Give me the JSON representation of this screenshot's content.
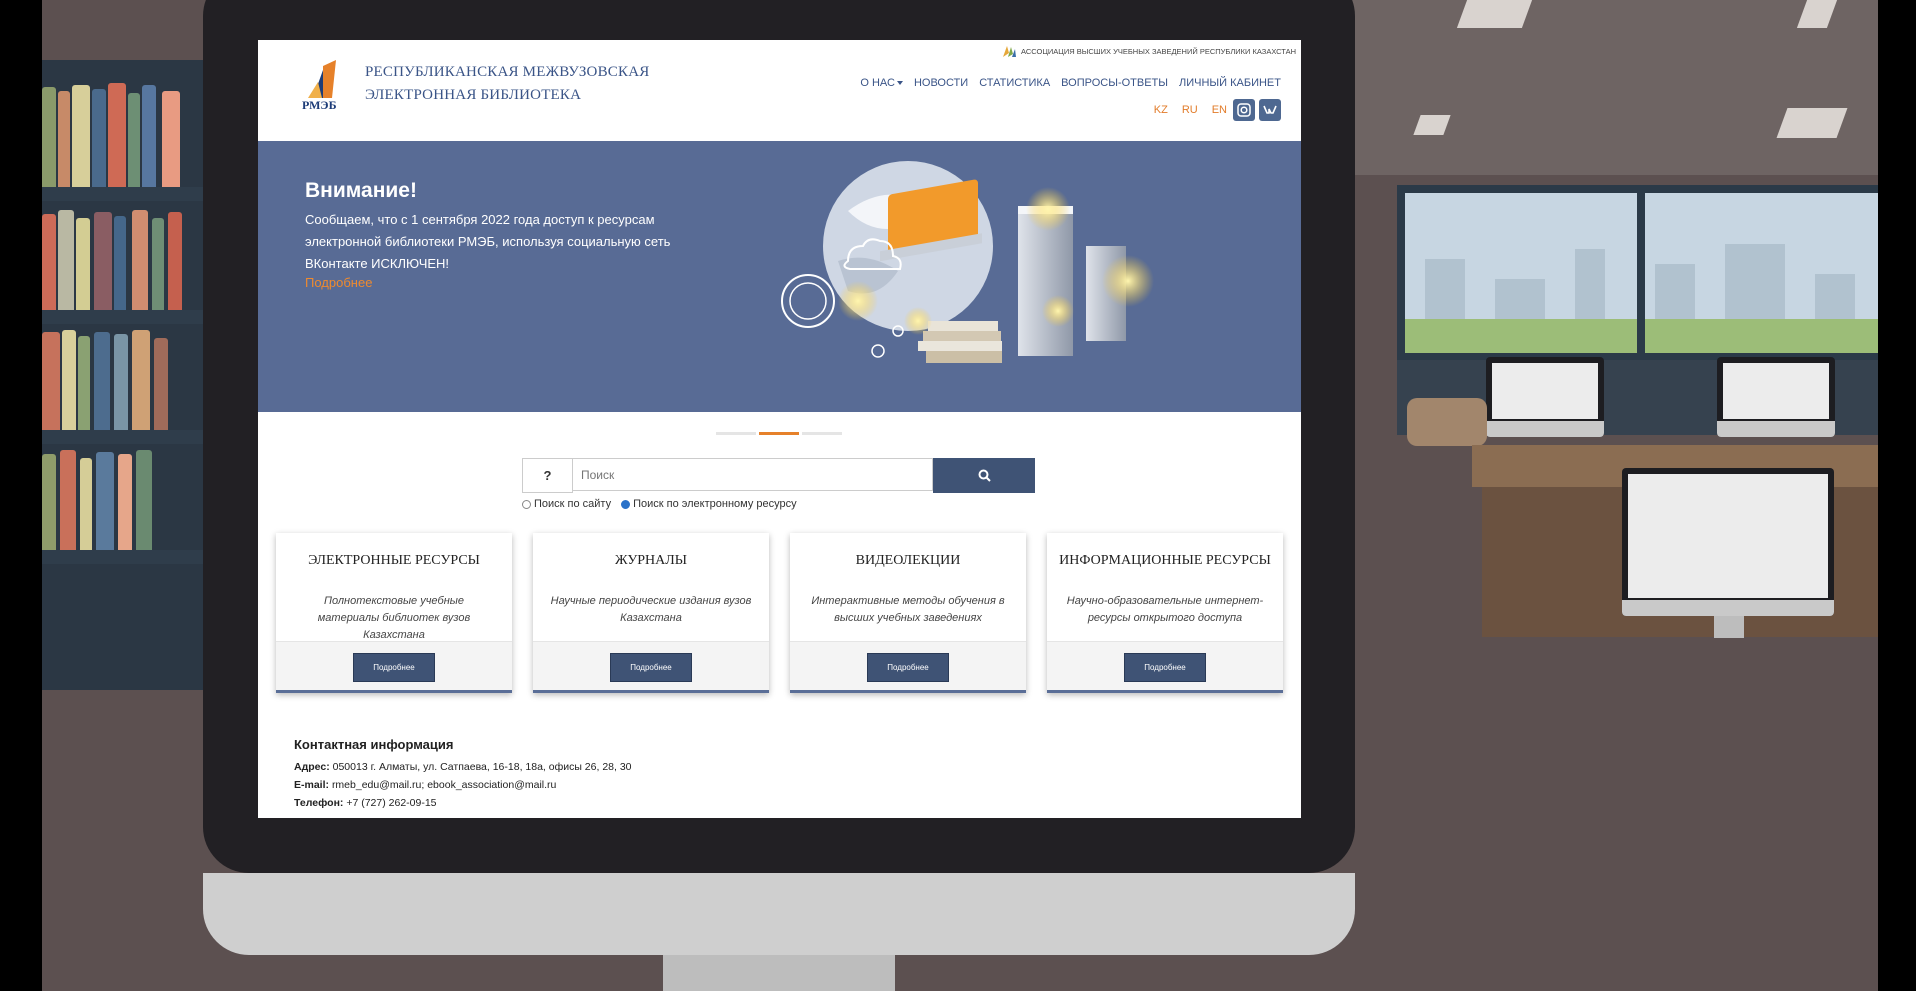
{
  "site": {
    "title_line1": "РЕСПУБЛИКАНСКАЯ МЕЖВУЗОВСКАЯ",
    "title_line2": "ЭЛЕКТРОННАЯ БИБЛИОТЕКА",
    "logo_abbr": "РМЭБ",
    "association": "АССОЦИАЦИЯ ВЫСШИХ УЧЕБНЫХ ЗАВЕДЕНИЙ РЕСПУБЛИКИ КАЗАХСТАН"
  },
  "nav": {
    "about": "О НАС",
    "news": "НОВОСТИ",
    "stats": "СТАТИСТИКА",
    "faq": "ВОПРОСЫ-ОТВЕТЫ",
    "cabinet": "ЛИЧНЫЙ КАБИНЕТ"
  },
  "langs": [
    "KZ",
    "RU",
    "EN"
  ],
  "social": {
    "instagram": "instagram-icon",
    "vk": "vk-icon"
  },
  "banner": {
    "title": "Внимание!",
    "text": "Сообщаем, что с 1 сентября 2022 года доступ к ресурсам электронной библиотеки РМЭБ, используя социальную сеть ВКонтакте ИСКЛЮЧЕН!",
    "more": "Подробнее",
    "bg_color": "#586b95"
  },
  "carousel": {
    "slides": 3,
    "active": 2
  },
  "search": {
    "help_label": "?",
    "placeholder": "Поиск",
    "radio_site": "Поиск по сайту",
    "radio_resource": "Поиск по электронному ресурсу",
    "selected": "radio_resource"
  },
  "cards": [
    {
      "title": "ЭЛЕКТРОННЫЕ РЕСУРСЫ",
      "desc": "Полнотекстовые учебные материалы библиотек вузов Казахстана",
      "button": "Подробнее"
    },
    {
      "title": "ЖУРНАЛЫ",
      "desc": "Научные периодические издания вузов Казахстана",
      "button": "Подробнее"
    },
    {
      "title": "ВИДЕОЛЕКЦИИ",
      "desc": "Интерактивные методы обучения в высших учебных заведениях",
      "button": "Подробнее"
    },
    {
      "title": "ИНФОРМАЦИОННЫЕ РЕСУРСЫ",
      "desc": "Научно-образовательные интернет-ресурсы открытого доступа",
      "button": "Подробнее"
    }
  ],
  "contact": {
    "title": "Контактная информация",
    "address_label": "Адрес:",
    "address": "050013 г. Алматы, ул. Сатпаева, 16-18, 18а, офисы 26, 28, 30",
    "email_label": "E-mail:",
    "email": "rmeb_edu@mail.ru; ebook_association@mail.ru",
    "phone_label": "Телефон:",
    "phone": "+7 (727) 262-09-15"
  },
  "colors": {
    "accent": "#e6812a",
    "brand": "#3f5375",
    "title": "#3a5487"
  }
}
